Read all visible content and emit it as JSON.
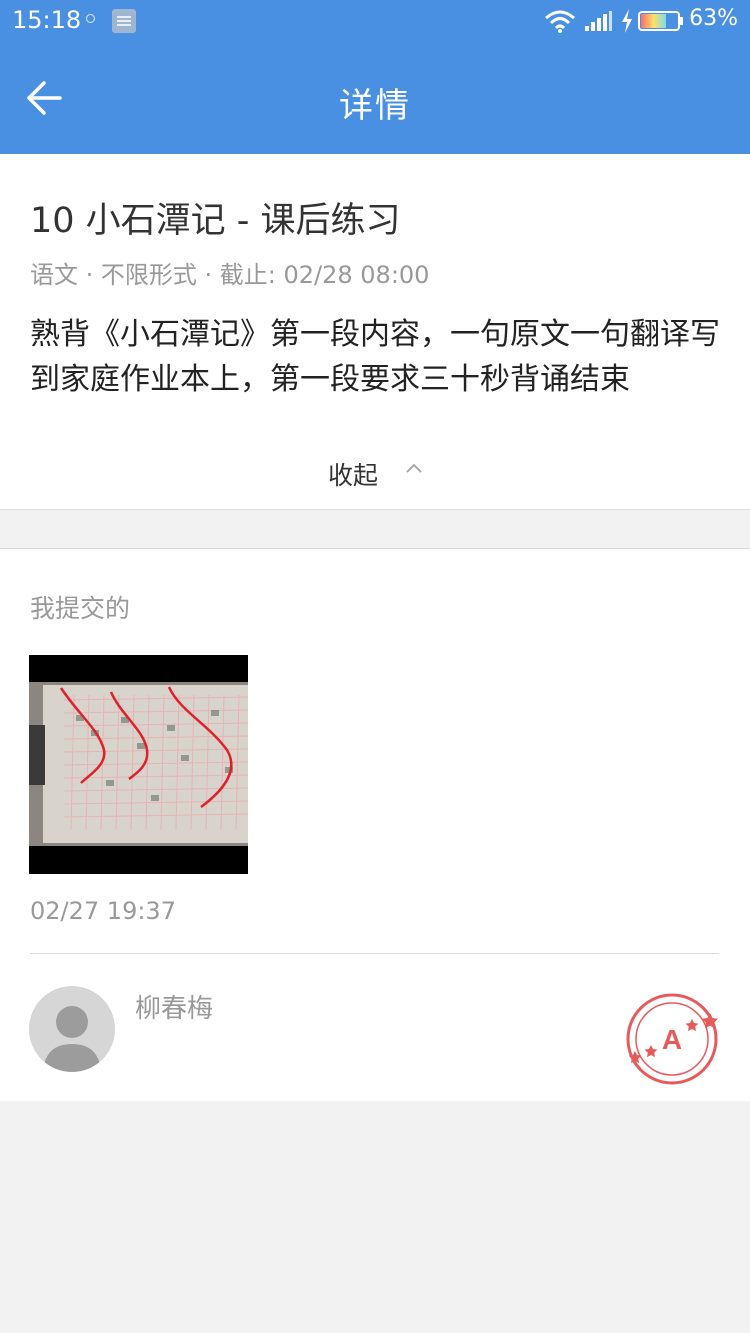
{
  "status_bar": {
    "time": "15:18",
    "battery_percent": "63%"
  },
  "header": {
    "title": "详情",
    "back_icon": "arrow-left-icon"
  },
  "homework": {
    "title": "10 小石潭记 - 课后练习",
    "subject": "语文",
    "form": "不限形式",
    "deadline": "截止: 02/28 08:00",
    "separator": " · ",
    "description": "熟背《小石潭记》第一段内容，一句原文一句翻译写到家庭作业本上，第一段要求三十秒背诵结束",
    "collapse_label": "收起"
  },
  "submission": {
    "section_label": "我提交的",
    "submitted_at": "02/27 19:37",
    "teacher_name": "柳春梅",
    "grade_letter": "A"
  },
  "colors": {
    "primary": "#4a90e2",
    "grade_stamp": "#e85a5a"
  }
}
